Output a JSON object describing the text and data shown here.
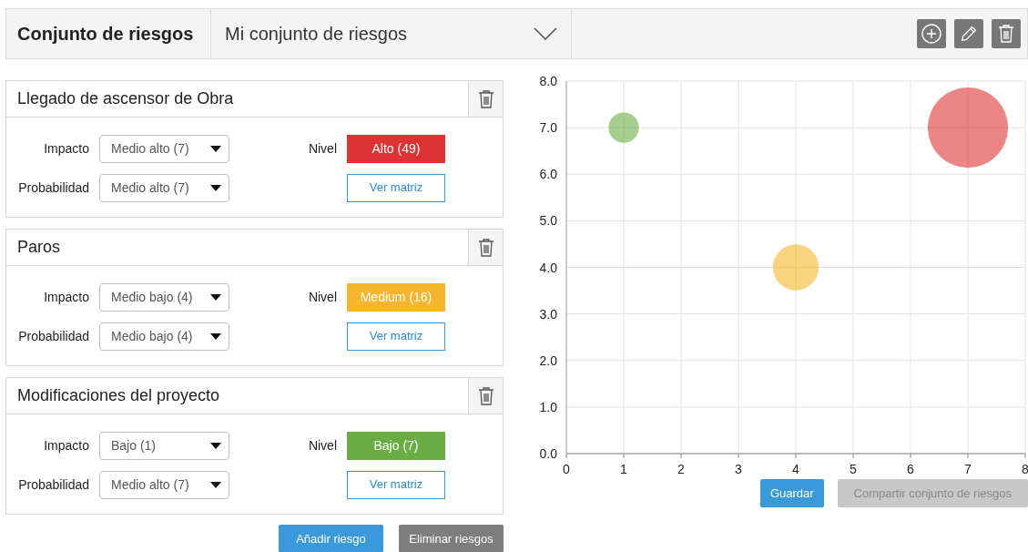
{
  "header": {
    "title": "Conjunto de riesgos",
    "selector": {
      "value": "Mi conjunto de riesgos"
    }
  },
  "risks": [
    {
      "title": "Llegado de ascensor de Obra",
      "impact_label": "Impacto",
      "impact": "Medio alto (7)",
      "probability_label": "Probabilidad",
      "probability": "Medio alto (7)",
      "level_label": "Nivel",
      "level_text": "Alto (49)",
      "color": "#dd3333",
      "matrix_button": "Ver matriz"
    },
    {
      "title": "Paros",
      "impact_label": "Impacto",
      "impact": "Medio bajo (4)",
      "probability_label": "Probabilidad",
      "probability": "Medio bajo (4)",
      "level_label": "Nivel",
      "level_text": "Medium (16)",
      "color": "#f6b52c",
      "matrix_button": "Ver matriz"
    },
    {
      "title": "Modificaciones del proyecto",
      "impact_label": "Impacto",
      "impact": "Bajo (1)",
      "probability_label": "Probabilidad",
      "probability": "Medio alto (7)",
      "level_label": "Nivel",
      "level_text": "Bajo (7)",
      "color": "#6aad45",
      "matrix_button": "Ver matriz"
    }
  ],
  "buttons": [
    {
      "label": "Añadir riesgo",
      "kind": "primary"
    },
    {
      "label": "Eliminar riesgos",
      "kind": "secondary"
    }
  ],
  "chart_data": {
    "type": "scatter",
    "grid": true,
    "x": [
      1,
      4,
      7
    ],
    "xlim": [
      0,
      8
    ],
    "ylim": [
      0,
      8
    ],
    "xticks": [
      0,
      1,
      2,
      3,
      4,
      5,
      6,
      7,
      8
    ],
    "yticks": [
      {
        "value": 0,
        "label": "0.0"
      },
      {
        "value": 1,
        "label": "1.0"
      },
      {
        "value": 2,
        "label": "2.0"
      },
      {
        "value": 3,
        "label": "3.0"
      },
      {
        "value": 4,
        "label": "4.0"
      },
      {
        "value": 5,
        "label": "5.0"
      },
      {
        "value": 6,
        "label": "6.0"
      },
      {
        "value": 7,
        "label": "7.0"
      },
      {
        "value": 8,
        "label": "8.0"
      }
    ],
    "series": [
      {
        "color": "#6aad45",
        "values": [
          7,
          null,
          null
        ]
      },
      {
        "color": "#f6b52c",
        "values": [
          null,
          4,
          null
        ]
      },
      {
        "color": "#dd3333",
        "values": [
          null,
          null,
          7
        ]
      }
    ]
  },
  "chart_buttons": [
    {
      "label": "Guardar",
      "disabled": false
    },
    {
      "label": "Compartir conjunto de riesgos",
      "disabled": true
    }
  ]
}
